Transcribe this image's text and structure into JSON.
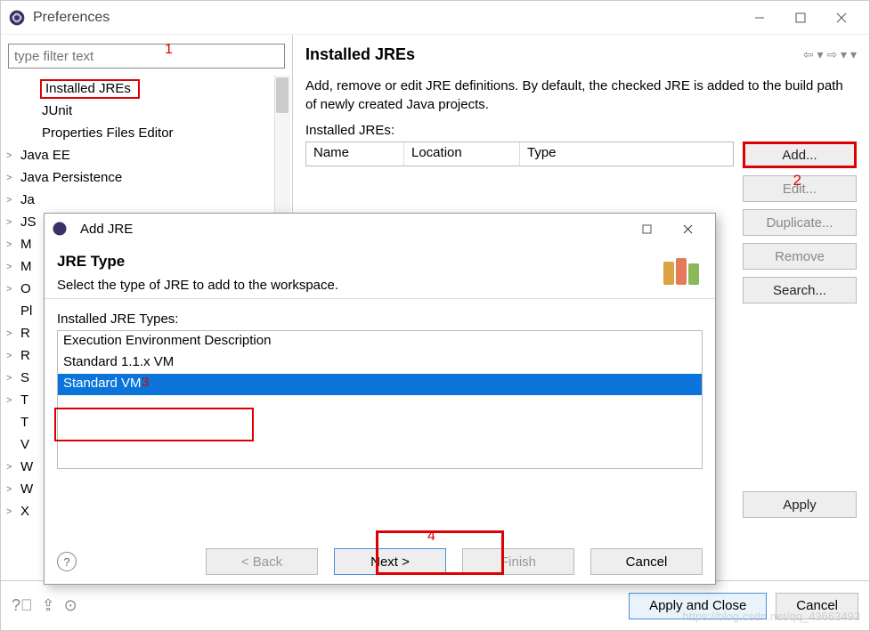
{
  "window": {
    "title": "Preferences"
  },
  "filter": {
    "placeholder": "type filter text"
  },
  "annotations": {
    "one": "1",
    "two": "2",
    "three": "3",
    "four": "4"
  },
  "tree": {
    "items": [
      {
        "label": "Installed JREs",
        "indent": true,
        "selected": true,
        "caret": ""
      },
      {
        "label": "JUnit",
        "indent": true,
        "caret": ""
      },
      {
        "label": "Properties Files Editor",
        "indent": true,
        "caret": ""
      },
      {
        "label": "Java EE",
        "caret": ">"
      },
      {
        "label": "Java Persistence",
        "caret": ">"
      },
      {
        "label": "Ja",
        "caret": ">"
      },
      {
        "label": "JS",
        "caret": ">"
      },
      {
        "label": "M",
        "caret": ">"
      },
      {
        "label": "M",
        "caret": ">"
      },
      {
        "label": "O",
        "caret": ">"
      },
      {
        "label": "Pl",
        "caret": ""
      },
      {
        "label": "R",
        "caret": ">"
      },
      {
        "label": "R",
        "caret": ">"
      },
      {
        "label": "S",
        "caret": ">"
      },
      {
        "label": "T",
        "caret": ">"
      },
      {
        "label": "T",
        "caret": ""
      },
      {
        "label": "V",
        "caret": ""
      },
      {
        "label": "W",
        "caret": ">"
      },
      {
        "label": "W",
        "caret": ">"
      },
      {
        "label": "X",
        "caret": ">"
      }
    ]
  },
  "page": {
    "title": "Installed JREs",
    "desc": "Add, remove or edit JRE definitions. By default, the checked JRE is added to the build path of newly created Java projects.",
    "sub": "Installed JREs:",
    "cols": {
      "name": "Name",
      "location": "Location",
      "type": "Type"
    },
    "buttons": {
      "add": "Add...",
      "edit": "Edit...",
      "duplicate": "Duplicate...",
      "remove": "Remove",
      "search": "Search..."
    },
    "apply": "Apply"
  },
  "bottom": {
    "apply_close": "Apply and Close",
    "cancel": "Cancel"
  },
  "dialog": {
    "title": "Add JRE",
    "heading": "JRE Type",
    "sub": "Select the type of JRE to add to the workspace.",
    "list_label": "Installed JRE Types:",
    "rows": [
      {
        "label": "Execution Environment Description",
        "selected": false
      },
      {
        "label": "Standard 1.1.x VM",
        "selected": false
      },
      {
        "label": "Standard VM",
        "selected": true
      }
    ],
    "buttons": {
      "back": "< Back",
      "next": "Next >",
      "finish": "Finish",
      "cancel": "Cancel"
    }
  },
  "watermark": "https://blog.csdn.net/qq_43663493"
}
